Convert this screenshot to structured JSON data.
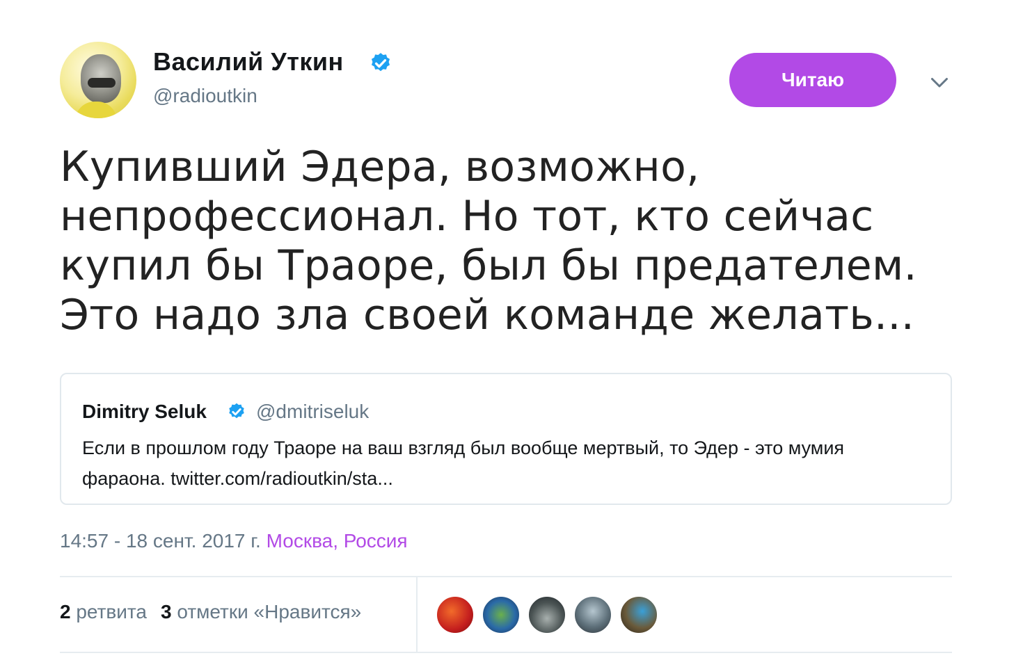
{
  "author": {
    "name": "Василий Уткин",
    "handle": "@radioutkin",
    "verified": true
  },
  "follow_button": {
    "label": "Читаю",
    "color": "#b24ae6"
  },
  "tweet": {
    "text": "Купивший Эдера, возможно, непрофессионал. Но тот, кто сейчас купил бы Траоре, был бы предателем. Это надо зла своей команде желать..."
  },
  "quoted_tweet": {
    "name": "Dimitry Seluk",
    "handle": "@dmitriseluk",
    "verified": true,
    "text": "Если в прошлом году Траоре на ваш взгляд был вообще мертвый, то Эдер - это мумия фараона. twitter.com/radioutkin/sta..."
  },
  "meta": {
    "timestamp": "14:57 - 18 сент. 2017 г.",
    "location": "Москва, Россия"
  },
  "stats": {
    "retweets_count": "2",
    "retweets_label": "ретвита",
    "likes_count": "3",
    "likes_label": "отметки «Нравится»"
  },
  "colors": {
    "accent": "#b24ae6",
    "verified": "#1da1f2",
    "secondary_text": "#657786"
  }
}
